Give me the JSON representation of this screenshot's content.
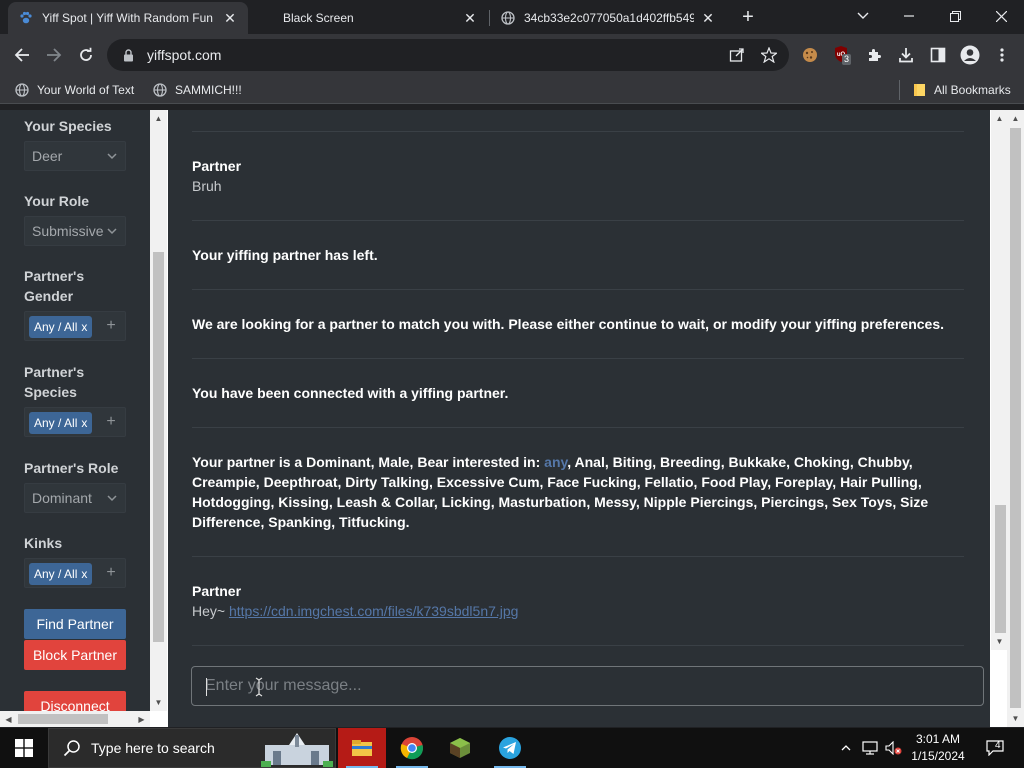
{
  "browser": {
    "tabs": [
      {
        "title": "Yiff Spot | Yiff With Random Fun",
        "active": true
      },
      {
        "title": "Black Screen",
        "active": false
      },
      {
        "title": "34cb33e2c077050a1d402ffb549",
        "active": false
      }
    ],
    "url": "yiffspot.com",
    "extension_badge": "3",
    "bookmarks": [
      "Your World of Text",
      "SAMMICH!!!"
    ],
    "all_bookmarks": "All Bookmarks"
  },
  "sidebar": {
    "species_label": "Your Species",
    "species_value": "Deer",
    "role_label": "Your Role",
    "role_value": "Submissive",
    "partner_gender_label": "Partner's Gender",
    "partner_gender_tag": "Any / All",
    "partner_species_label": "Partner's Species",
    "partner_species_tag": "Any / All",
    "partner_role_label": "Partner's Role",
    "partner_role_value": "Dominant",
    "kinks_label": "Kinks",
    "kinks_tag": "Any / All",
    "tag_remove": "x",
    "tag_add": "+",
    "find_partner": "Find Partner",
    "block_partner": "Block Partner",
    "disconnect": "Disconnect"
  },
  "chat": {
    "messages": [
      {
        "author": "Partner",
        "text": "Bruh"
      },
      {
        "system": "Your yiffing partner has left."
      },
      {
        "system": "We are looking for a partner to match you with. Please either continue to wait, or modify your yiffing preferences."
      },
      {
        "system": "You have been connected with a yiffing partner."
      },
      {
        "system_prefix": "Your partner is a Dominant, Male, Bear interested in: ",
        "any": "any",
        "system_suffix": ", Anal, Biting, Breeding, Bukkake, Choking, Chubby, Creampie, Deepthroat, Dirty Talking, Excessive Cum, Face Fucking, Fellatio, Food Play, Foreplay, Hair Pulling, Hotdogging, Kissing, Leash & Collar, Licking, Masturbation, Messy, Nipple Piercings, Piercings, Sex Toys, Size Difference, Spanking, Titfucking."
      },
      {
        "author": "Partner",
        "text": "Hey~ ",
        "link": "https://cdn.imgchest.com/files/k739sbdl5n7.jpg"
      }
    ],
    "input_placeholder": "Enter your message..."
  },
  "taskbar": {
    "search_placeholder": "Type here to search",
    "time": "3:01 AM",
    "date": "1/15/2024",
    "notification_count": "4"
  },
  "colors": {
    "accent_blue": "#3d6696",
    "danger_red": "#e1443d",
    "panel_bg": "#2b3035"
  }
}
